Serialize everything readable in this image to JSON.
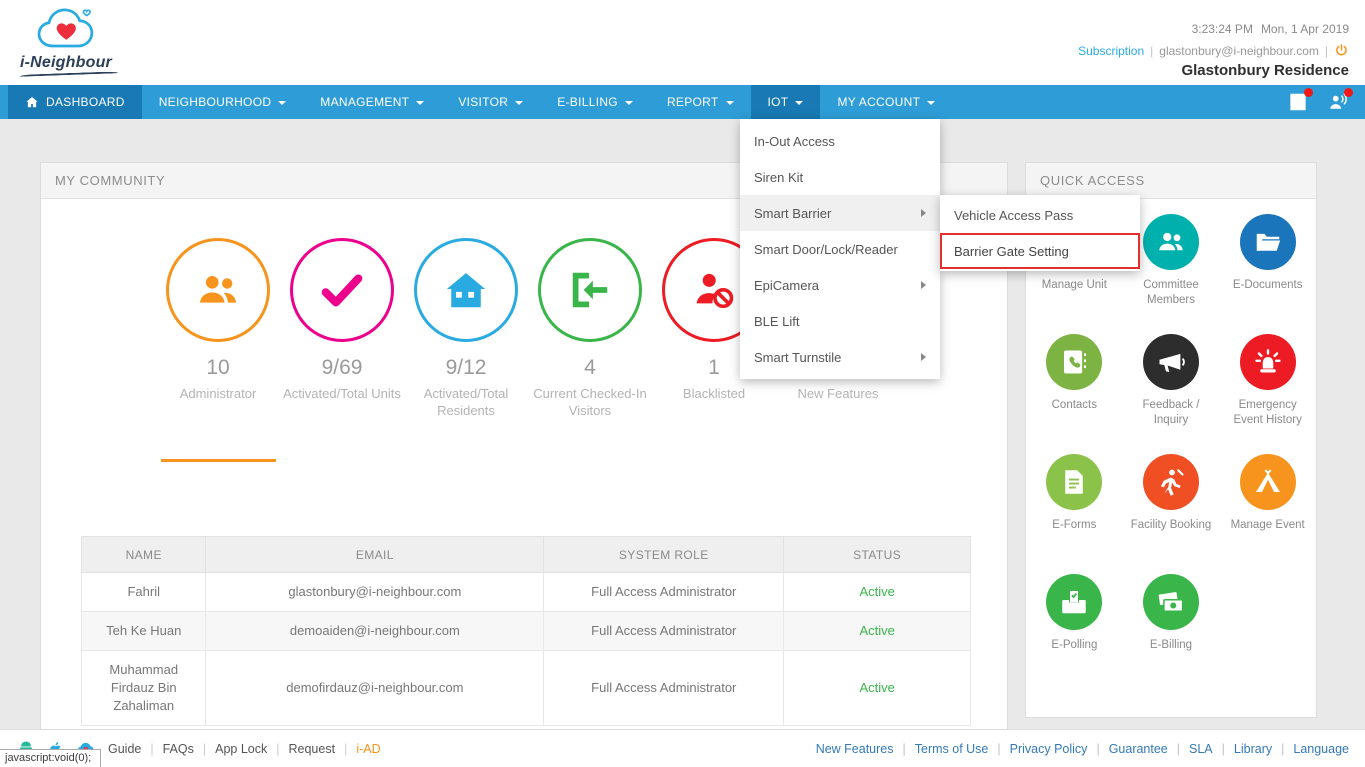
{
  "app": {
    "logo_text": "i-Neighbour"
  },
  "theme": {
    "nav_blue": "#2e9cd6",
    "nav_active_blue": "#1879b4",
    "accent_orange": "#f7941e",
    "link_blue": "#29abe2",
    "active_green": "#39b54a",
    "alert_red": "#ed1c24"
  },
  "header": {
    "time": "3:23:24 PM",
    "date": "Mon, 1 Apr 2019",
    "subscription": "Subscription",
    "separator": "|",
    "email": "glastonbury@i-neighbour.com",
    "residence": "Glastonbury Residence"
  },
  "nav": {
    "items": [
      {
        "label": "DASHBOARD",
        "icon": "home",
        "active": true,
        "caret": false
      },
      {
        "label": "NEIGHBOURHOOD",
        "caret": true
      },
      {
        "label": "MANAGEMENT",
        "caret": true
      },
      {
        "label": "VISITOR",
        "caret": true
      },
      {
        "label": "E-BILLING",
        "caret": true
      },
      {
        "label": "REPORT",
        "caret": true
      },
      {
        "label": "IOT",
        "caret": true,
        "open": true
      },
      {
        "label": "MY ACCOUNT",
        "caret": true
      }
    ],
    "right_icons": [
      {
        "name": "news",
        "badge": true
      },
      {
        "name": "person-wave",
        "badge": true
      }
    ]
  },
  "iot_menu": {
    "items": [
      {
        "label": "In-Out Access"
      },
      {
        "label": "Siren Kit"
      },
      {
        "label": "Smart Barrier",
        "submenu": true,
        "highlighted": true
      },
      {
        "label": "Smart Door/Lock/Reader"
      },
      {
        "label": "EpiCamera",
        "submenu": true
      },
      {
        "label": "BLE Lift"
      },
      {
        "label": "Smart Turnstile",
        "submenu": true
      }
    ],
    "submenu": {
      "items": [
        {
          "label": "Vehicle Access Pass"
        },
        {
          "label": "Barrier Gate Setting",
          "highlight_box": true
        }
      ]
    }
  },
  "community": {
    "title": "MY COMMUNITY",
    "stats": [
      {
        "value": "10",
        "label": "Administrator",
        "color": "#f7941e",
        "icon": "users"
      },
      {
        "value": "9/69",
        "label": "Activated/Total Units",
        "color": "#ec008c",
        "icon": "check"
      },
      {
        "value": "9/12",
        "label": "Activated/Total Residents",
        "color": "#29abe2",
        "icon": "home"
      },
      {
        "value": "4",
        "label": "Current Checked-In Visitors",
        "color": "#39b54a",
        "icon": "check-in"
      },
      {
        "value": "1",
        "label": "Blacklisted",
        "color": "#ed1c24",
        "icon": "user-block"
      },
      {
        "value": "",
        "label": "New Features",
        "color": "#f7941e",
        "icon": "megaphone"
      }
    ],
    "table": {
      "headers": [
        "NAME",
        "EMAIL",
        "SYSTEM ROLE",
        "STATUS"
      ],
      "rows": [
        {
          "name": "Fahril",
          "email": "glastonbury@i-neighbour.com",
          "role": "Full Access Administrator",
          "status": "Active"
        },
        {
          "name": "Teh Ke Huan",
          "email": "demoaiden@i-neighbour.com",
          "role": "Full Access Administrator",
          "status": "Active"
        },
        {
          "name": "Muhammad Firdauz Bin Zahaliman",
          "email": "demofirdauz@i-neighbour.com",
          "role": "Full Access Administrator",
          "status": "Active"
        }
      ],
      "status_color": "#39b54a"
    }
  },
  "quick_access": {
    "title": "QUICK ACCESS",
    "items": [
      {
        "label": "Manage Unit",
        "color": "#f7941e",
        "icon": "building"
      },
      {
        "label": "Committee Members",
        "color": "#00b0ad",
        "icon": "users"
      },
      {
        "label": "E-Documents",
        "color": "#1b75bb",
        "icon": "folder"
      },
      {
        "label": "Contacts",
        "color": "#7cb342",
        "icon": "contacts"
      },
      {
        "label": "Feedback / Inquiry",
        "color": "#2d2d2d",
        "icon": "megaphone"
      },
      {
        "label": "Emergency Event History",
        "color": "#ed1c24",
        "icon": "siren"
      },
      {
        "label": "E-Forms",
        "color": "#8bc34a",
        "icon": "doc"
      },
      {
        "label": "Facility Booking",
        "color": "#f04e23",
        "icon": "player"
      },
      {
        "label": "Manage Event",
        "color": "#f7941e",
        "icon": "tent"
      },
      {
        "label": "E-Polling",
        "color": "#39b54a",
        "icon": "ballot"
      },
      {
        "label": "E-Billing",
        "color": "#39b54a",
        "icon": "money"
      }
    ]
  },
  "footer": {
    "separator": "|",
    "icons": [
      {
        "name": "android",
        "color": "#26b99a"
      },
      {
        "name": "apple",
        "color": "#29abe2"
      },
      {
        "name": "cloud",
        "color": "#29abe2"
      }
    ],
    "left_links": [
      {
        "label": "Guide",
        "color": "#555555"
      },
      {
        "label": "FAQs",
        "color": "#555555"
      },
      {
        "label": "App Lock",
        "color": "#555555"
      },
      {
        "label": "Request",
        "color": "#555555"
      },
      {
        "label": "i-AD",
        "color": "#f7941e"
      }
    ],
    "right_links": [
      "New Features",
      "Terms of Use",
      "Privacy Policy",
      "Guarantee",
      "SLA",
      "Library",
      "Language"
    ]
  },
  "status_bar": {
    "text": "javascript:void(0);"
  }
}
